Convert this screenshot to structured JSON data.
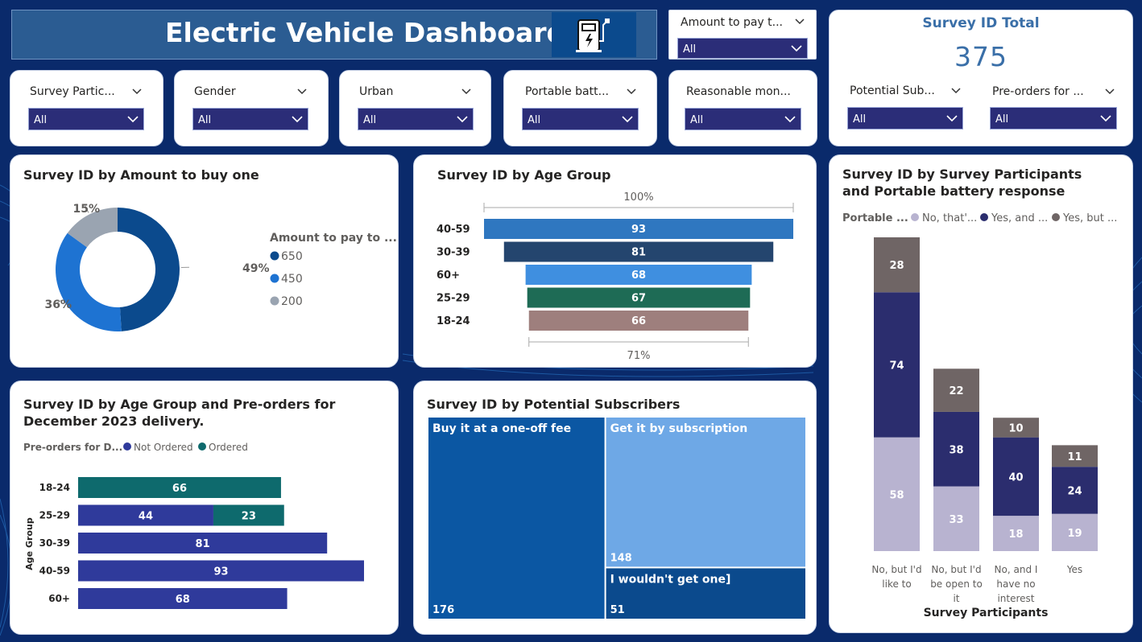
{
  "banner": {
    "title": "Electric Vehicle Dashboard",
    "icon": "ev-charger-icon"
  },
  "slicers": {
    "amount_to_pay": {
      "label": "Amount to pay t...",
      "value": "All"
    },
    "survey_participants": {
      "label": "Survey Partic...",
      "value": "All"
    },
    "gender": {
      "label": "Gender",
      "value": "All"
    },
    "urban": {
      "label": "Urban",
      "value": "All"
    },
    "portable_battery": {
      "label": "Portable batt...",
      "value": "All"
    },
    "reasonable_money": {
      "label": "Reasonable mon...",
      "value": "All"
    },
    "potential_sub": {
      "label": "Potential Sub...",
      "value": "All"
    },
    "preorders": {
      "label": "Pre-orders for ...",
      "value": "All"
    }
  },
  "kpi": {
    "title": "Survey ID Total",
    "value": "375"
  },
  "colors": {
    "background": "#0a2a6b",
    "slicer_fill": "#2b2d78",
    "dark_blue": "#0b4a8d",
    "mid_blue": "#1e73d2",
    "grey": "#9aa4b1",
    "navy": "#2b2d78",
    "lavender": "#b8b3d0",
    "taupe": "#6f6565",
    "teal": "#0e6a6d",
    "indigo": "#2f3a9b"
  },
  "chart_data": [
    {
      "id": "amount_donut",
      "type": "pie",
      "title": "Survey ID by Amount to buy one",
      "legend_title": "Amount to pay to ...",
      "legend_placement": "right",
      "slices": [
        {
          "label": "650",
          "percent": 49,
          "percent_label": "49%",
          "color": "#0b4a8d"
        },
        {
          "label": "450",
          "percent": 36,
          "percent_label": "36%",
          "color": "#1e73d2"
        },
        {
          "label": "200",
          "percent": 15,
          "percent_label": "15%",
          "color": "#9aa4b1"
        }
      ]
    },
    {
      "id": "age_funnel",
      "type": "bar",
      "title": "Survey ID by Age Group",
      "top_label": "100%",
      "bottom_label": "71%",
      "categories": [
        "40-59",
        "30-39",
        "60+",
        "25-29",
        "18-24"
      ],
      "values": [
        93,
        81,
        68,
        67,
        66
      ],
      "colors": [
        "#2f77c0",
        "#24456e",
        "#3f8fe0",
        "#1e6b55",
        "#9e7f7d"
      ]
    },
    {
      "id": "participants_battery",
      "type": "bar",
      "title": "Survey ID by Survey Participants and Portable battery response",
      "legend_title": "Portable ...",
      "legend_placement": "top",
      "xlabel": "Survey Participants",
      "categories": [
        "No, but I'd like to",
        "No, but I'd be open to it",
        "No, and I have no interest",
        "Yes"
      ],
      "category_lines": [
        [
          "No, but I'd",
          "like to"
        ],
        [
          "No, but I'd",
          "be open to",
          "it"
        ],
        [
          "No, and I",
          "have no",
          "interest"
        ],
        [
          "Yes"
        ]
      ],
      "series": [
        {
          "name": "No, that'...",
          "values": [
            58,
            33,
            18,
            19
          ],
          "color": "#b8b3d0"
        },
        {
          "name": "Yes, and ...",
          "values": [
            74,
            38,
            40,
            24
          ],
          "color": "#2b2d6e"
        },
        {
          "name": "Yes, but ...",
          "values": [
            28,
            22,
            10,
            11
          ],
          "color": "#6f6565"
        }
      ]
    },
    {
      "id": "age_preorders",
      "type": "bar",
      "title": "Survey ID by Age Group and Pre-orders for December 2023 delivery.",
      "legend_title": "Pre-orders for D...",
      "legend_placement": "top",
      "ylabel": "Age Group",
      "categories": [
        "18-24",
        "25-29",
        "30-39",
        "40-59",
        "60+"
      ],
      "series": [
        {
          "name": "Not Ordered",
          "values": [
            0,
            44,
            81,
            93,
            68
          ],
          "color": "#2f3a9b"
        },
        {
          "name": "Ordered",
          "values": [
            66,
            23,
            0,
            0,
            0
          ],
          "color": "#0e6a6d"
        }
      ]
    },
    {
      "id": "potential_subscribers",
      "type": "heatmap",
      "title": "Survey ID by Potential Subscribers",
      "items": [
        {
          "label": "Buy it at a one-off fee",
          "value": 176,
          "color": "#0b57a3"
        },
        {
          "label": "Get it by subscription",
          "value": 148,
          "color": "#6ea8e6"
        },
        {
          "label": "I wouldn't get one]",
          "value": 51,
          "color": "#0b4a8d"
        }
      ]
    }
  ]
}
